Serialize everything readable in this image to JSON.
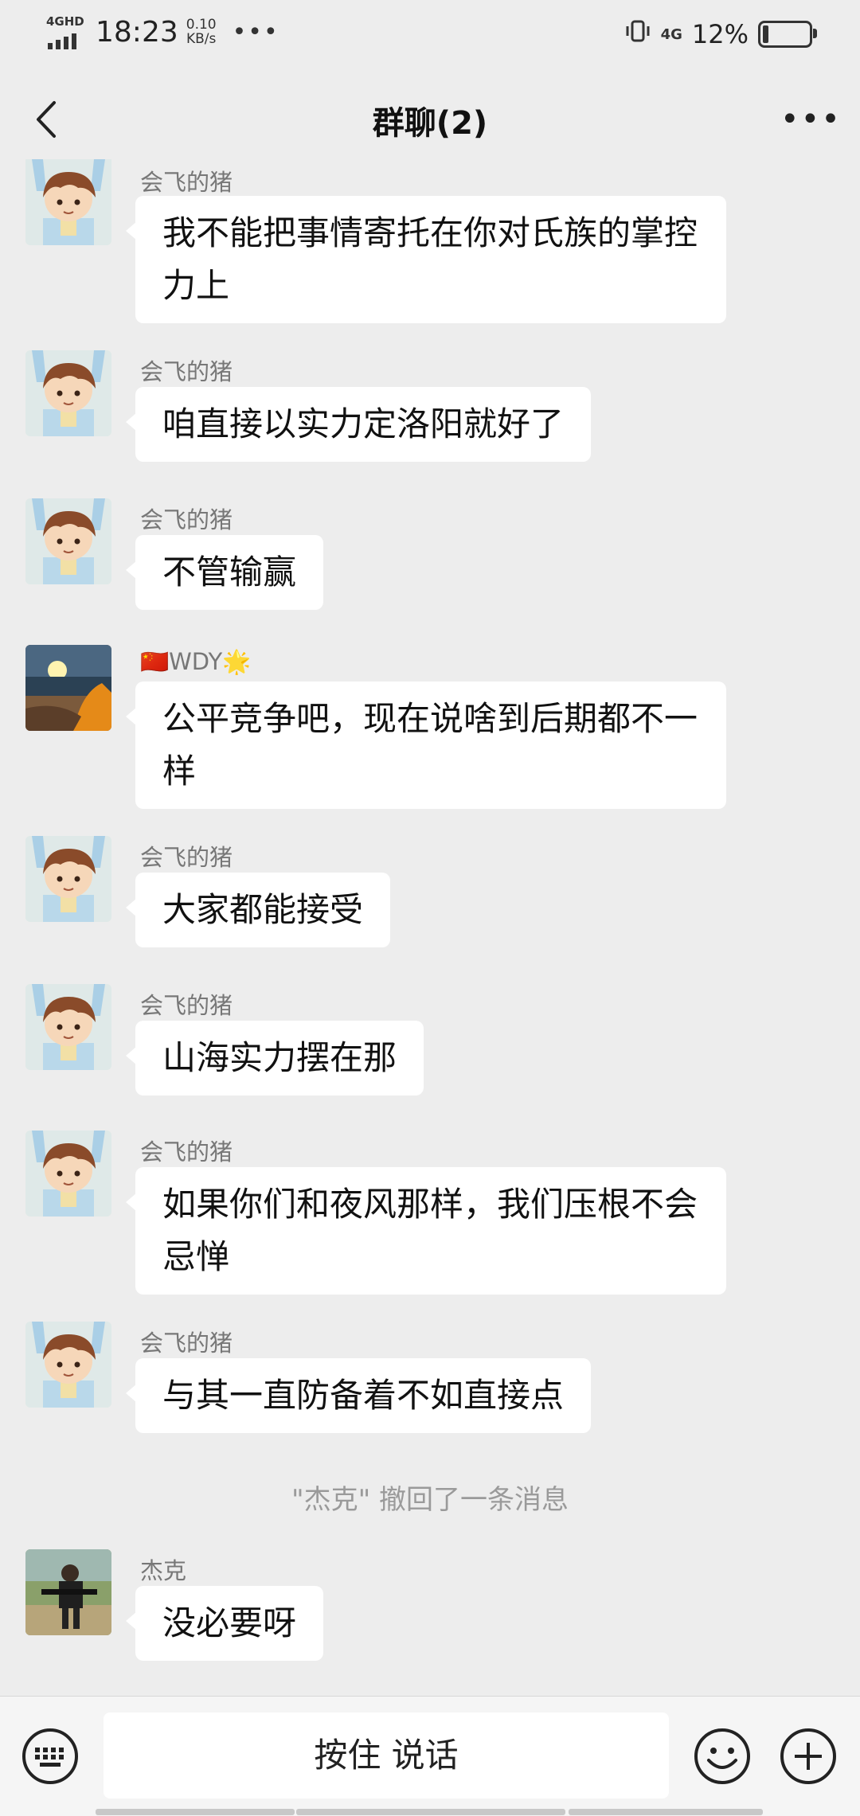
{
  "status_bar": {
    "network": "4GHD",
    "time": "18:23",
    "speed_value": "0.10",
    "speed_unit": "KB/s",
    "more": "•••",
    "network2": "4G",
    "battery": "12%",
    "battery_level": 0.12
  },
  "header": {
    "title": "群聊(2)",
    "back_icon": "chevron-left-icon",
    "more_icon": "more-horizontal-icon",
    "more_text": "•••"
  },
  "messages": [
    {
      "sender": "会飞的猪",
      "text": "我不能把事情寄托在你对氏族的掌控力上"
    },
    {
      "sender": "会飞的猪",
      "text": "咱直接以实力定洛阳就好了"
    },
    {
      "sender": "会飞的猪",
      "text": "不管输赢"
    },
    {
      "sender": "WDY",
      "sender_prefix": "🇨🇳",
      "sender_suffix": "🌟",
      "text": "公平竞争吧，现在说啥到后期都不一样"
    },
    {
      "sender": "会飞的猪",
      "text": "大家都能接受"
    },
    {
      "sender": "会飞的猪",
      "text": "山海实力摆在那"
    },
    {
      "sender": "会飞的猪",
      "text": "如果你们和夜风那样，我们压根不会忌惮"
    },
    {
      "sender": "会飞的猪",
      "text": "与其一直防备着不如直接点"
    },
    {
      "sender": "杰克",
      "text": "没必要呀"
    }
  ],
  "recall_notice": "\"杰克\" 撤回了一条消息",
  "input_bar": {
    "hold_to_talk": "按住 说话",
    "keyboard_icon": "keyboard-icon",
    "emoji_icon": "emoji-icon",
    "plus_icon": "plus-circle-icon"
  },
  "colors": {
    "background": "#ededed",
    "bubble": "#ffffff",
    "sender_text": "#777777",
    "system_text": "#9a9a9a"
  }
}
